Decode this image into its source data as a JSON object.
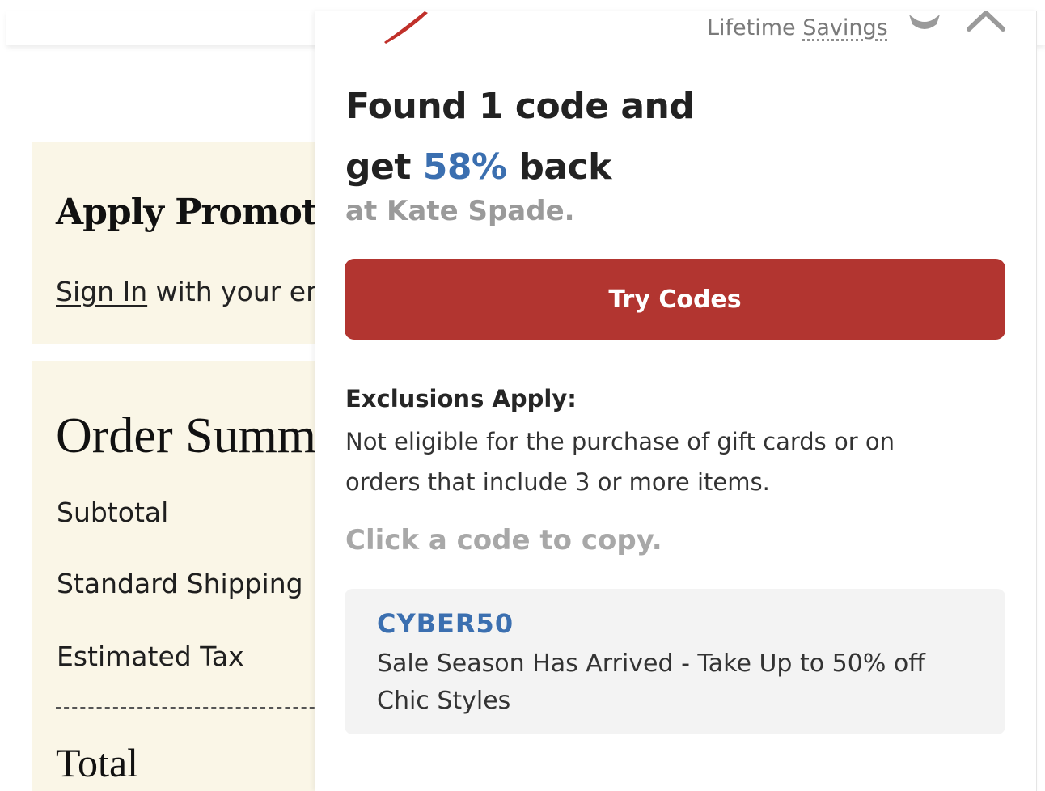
{
  "background_page": {
    "promo_card": {
      "title": "Apply Promoti",
      "signin_link": "Sign In",
      "signin_rest": " with your em"
    },
    "order_summary": {
      "title": "Order Summ",
      "rows": [
        "Subtotal",
        "Standard Shipping",
        "Estimated Tax"
      ],
      "total_label": "Total"
    }
  },
  "panel": {
    "header": {
      "lifetime_prefix": "Lifetime ",
      "lifetime_link": "Savings",
      "icons": [
        "logo-icon",
        "gear-icon",
        "close-icon"
      ]
    },
    "headline_line1": "Found 1 code and",
    "headline_line2_pre": "get ",
    "headline_pct": "58%",
    "headline_line2_post": " back",
    "store_line": "at Kate Spade.",
    "try_button": "Try Codes",
    "exclusions_title": "Exclusions Apply:",
    "exclusions_text": "Not eligible for the purchase of gift cards or on orders that include 3 or more items.",
    "click_to_copy": "Click a code to copy.",
    "codes": [
      {
        "code": "CYBER50",
        "description": "Sale Season Has Arrived - Take Up to 50% off Chic Styles"
      }
    ]
  },
  "colors": {
    "accent_red": "#b23530",
    "accent_blue": "#3b6fb0",
    "card_bg": "#faf6e7",
    "code_card_bg": "#f3f3f3"
  }
}
